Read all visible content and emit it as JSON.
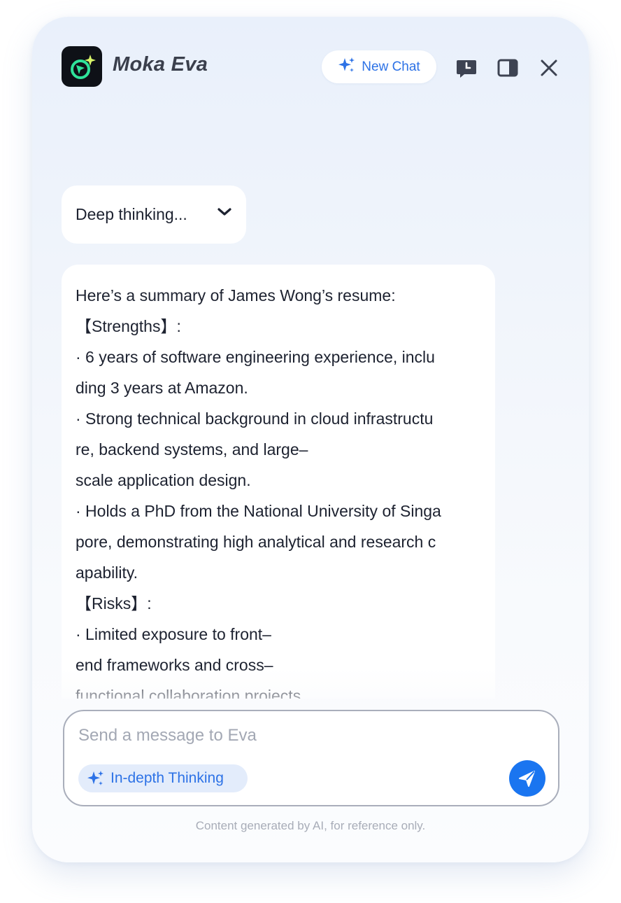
{
  "app": {
    "title": "Moka Eva",
    "icon": "moka-logo-icon"
  },
  "header": {
    "new_chat_label": "New Chat",
    "icons": [
      "sparkle-icon",
      "history-icon",
      "sidebar-toggle-icon",
      "close-icon"
    ]
  },
  "thinking": {
    "label": "Deep thinking...",
    "icon": "chevron-down-icon"
  },
  "message": {
    "lines": [
      "Here’s a summary of James Wong’s resume:",
      "【Strengths】:",
      "· 6 years of software engineering experience, inclu",
      "ding 3 years at Amazon.",
      "· Strong technical background in cloud infrastructu",
      "re, backend systems, and large–",
      "scale application design.",
      "· Holds a PhD from the National University of Singa",
      "pore, demonstrating high analytical and research c",
      "apability.",
      "【Risks】:",
      "· Limited exposure to front–",
      "end frameworks and cross–",
      "functional collaboration projects."
    ]
  },
  "composer": {
    "placeholder": "Send a message to Eva",
    "value": "",
    "deep_thinking_label": "In-depth Thinking",
    "send_icon": "send-icon"
  },
  "footer": {
    "disclaimer": "Content generated by AI, for reference only."
  },
  "colors": {
    "accent": "#1a75f0",
    "accent_text": "#2d72e6",
    "chip_bg": "#e3ecfb",
    "text": "#1d2230"
  }
}
